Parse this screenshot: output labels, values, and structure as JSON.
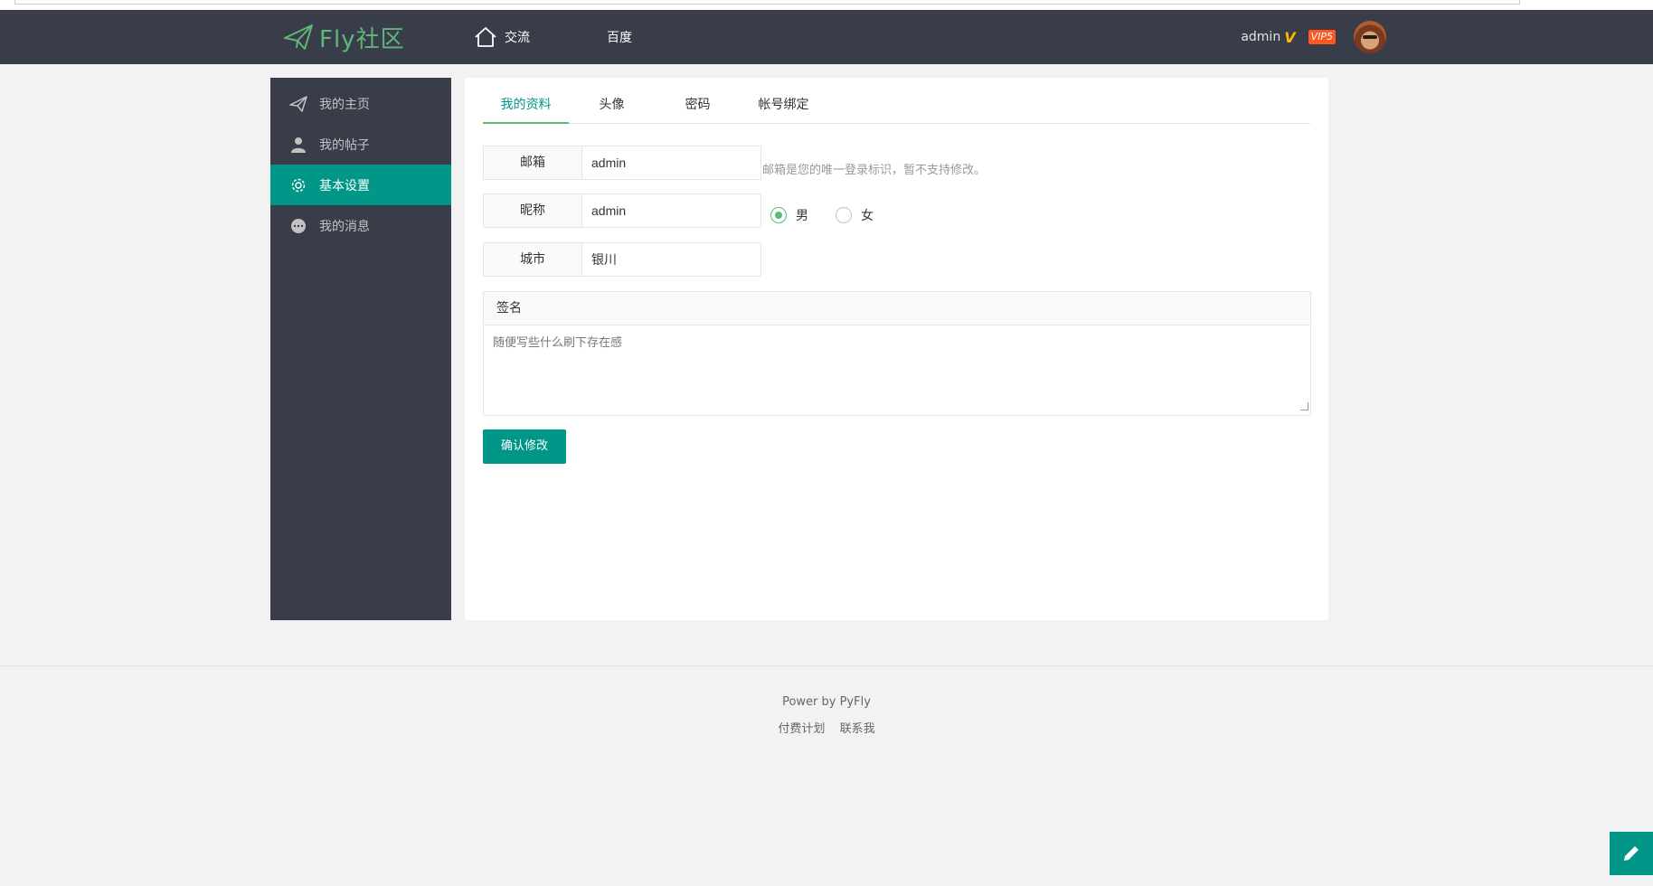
{
  "header": {
    "logo_text": "Fly社区",
    "nav": [
      {
        "label": "交流",
        "icon": "home-icon"
      },
      {
        "label": "百度"
      }
    ],
    "user": {
      "name": "admin",
      "verified_badge": "V",
      "vip_label": "VIP5"
    }
  },
  "sidebar": {
    "items": [
      {
        "label": "我的主页",
        "icon": "paper-plane-icon"
      },
      {
        "label": "我的帖子",
        "icon": "user-icon"
      },
      {
        "label": "基本设置",
        "icon": "gear-icon",
        "active": true
      },
      {
        "label": "我的消息",
        "icon": "chat-icon"
      }
    ]
  },
  "tabs": [
    {
      "label": "我的资料",
      "active": true
    },
    {
      "label": "头像"
    },
    {
      "label": "密码"
    },
    {
      "label": "帐号绑定"
    }
  ],
  "form": {
    "email": {
      "label": "邮箱",
      "value": "admin",
      "hint": "邮箱是您的唯一登录标识，暂不支持修改。"
    },
    "nickname": {
      "label": "昵称",
      "value": "admin"
    },
    "gender": {
      "options": [
        "男",
        "女"
      ],
      "selected": "男"
    },
    "city": {
      "label": "城市",
      "value": "银川"
    },
    "signature": {
      "label": "签名",
      "placeholder": "随便写些什么刷下存在感"
    },
    "submit_label": "确认修改"
  },
  "footer": {
    "power": "Power by PyFly",
    "links": [
      "付费计划",
      "联系我"
    ]
  },
  "colors": {
    "header_bg": "#393d49",
    "accent": "#009688",
    "logo": "#5fb878",
    "vip": "#ff5722"
  }
}
